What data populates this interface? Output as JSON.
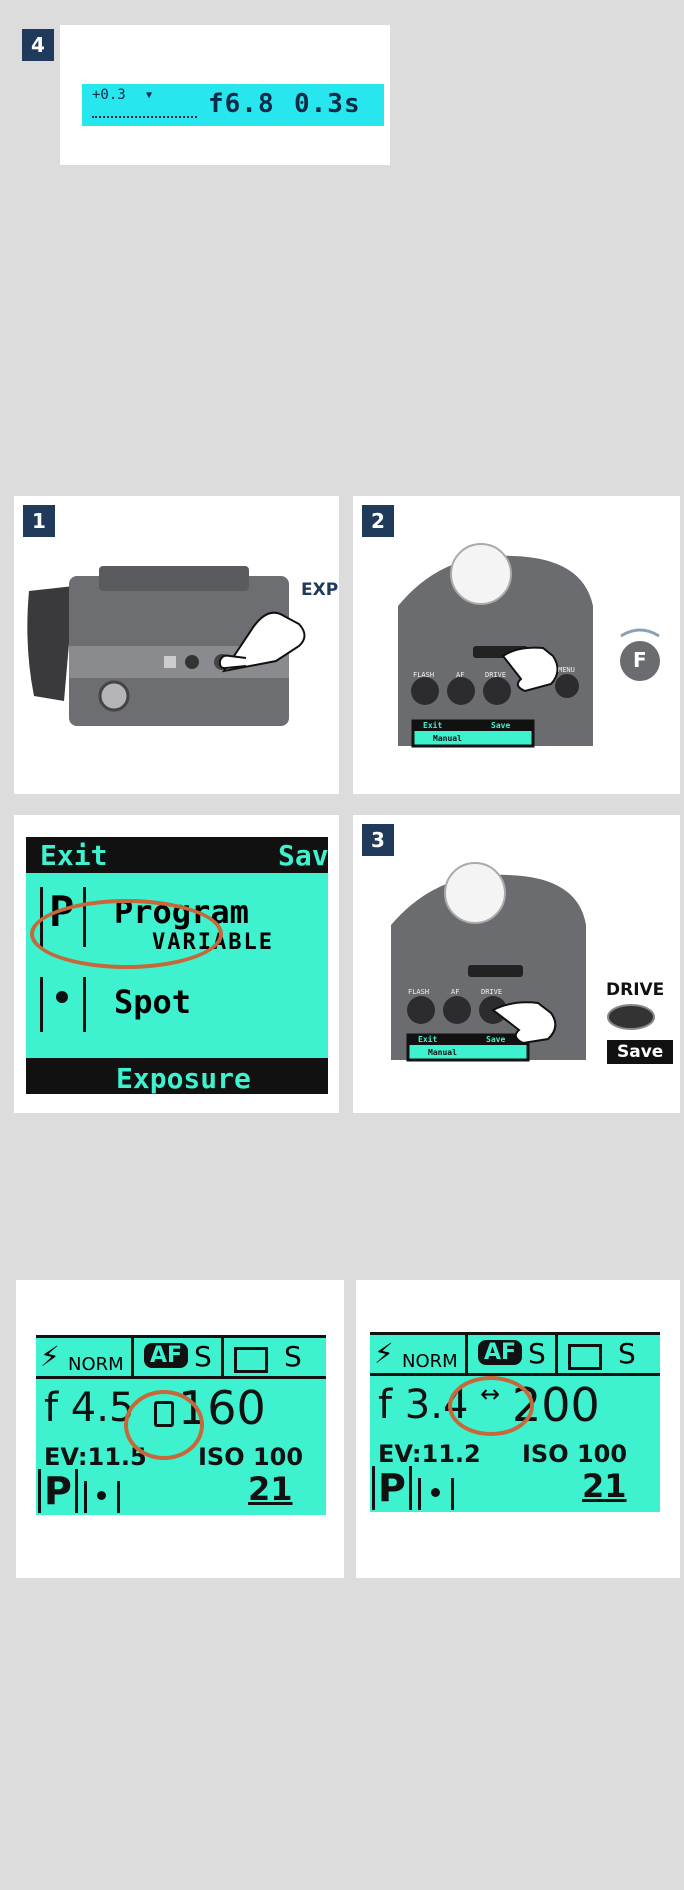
{
  "panel_top": {
    "step": "4",
    "exposure_comp": "+0.3",
    "aperture": "f6.8",
    "shutter": "0.3s"
  },
  "panel1": {
    "step": "1",
    "callout": "EXP"
  },
  "panel2": {
    "step": "2",
    "dial_icon_letter": "F",
    "buttons": [
      "FLASH",
      "AF",
      "DRIVE",
      "MENU"
    ],
    "screen_exit": "Exit",
    "screen_save": "Save",
    "screen_mode": "Manual"
  },
  "panel_lcd_menu": {
    "header_exit": "Exit",
    "header_save": "Sav",
    "item1_mode_letter": "P",
    "item1_title": "Program",
    "item1_sub": "VARIABLE",
    "item2_title": "Spot",
    "footer": "Exposure"
  },
  "panel3": {
    "step": "3",
    "callout": "DRIVE",
    "save_label": "Save",
    "buttons": [
      "FLASH",
      "AF",
      "DRIVE"
    ],
    "screen_exit": "Exit",
    "screen_save": "Save",
    "screen_mode": "Manual"
  },
  "lcd_left": {
    "flash_label": "NORM",
    "af_label": "AF",
    "af_mode": "S",
    "drive_mode": "S",
    "aperture": "f 4.5",
    "shutter": "160",
    "ev": "EV:11.5",
    "iso": "ISO 100",
    "mode": "P",
    "frames": "21"
  },
  "lcd_right": {
    "flash_label": "NORM",
    "af_label": "AF",
    "af_mode": "S",
    "drive_mode": "S",
    "aperture": "f 3.4",
    "shutter": "200",
    "ev": "EV:11.2",
    "iso": "ISO 100",
    "mode": "P",
    "frames": "21"
  },
  "colors": {
    "lcd_teal": "#3ef2cf",
    "strip_cyan": "#28e6ee",
    "step_navy": "#1f3a5a",
    "ring_orange": "#c7683a"
  }
}
